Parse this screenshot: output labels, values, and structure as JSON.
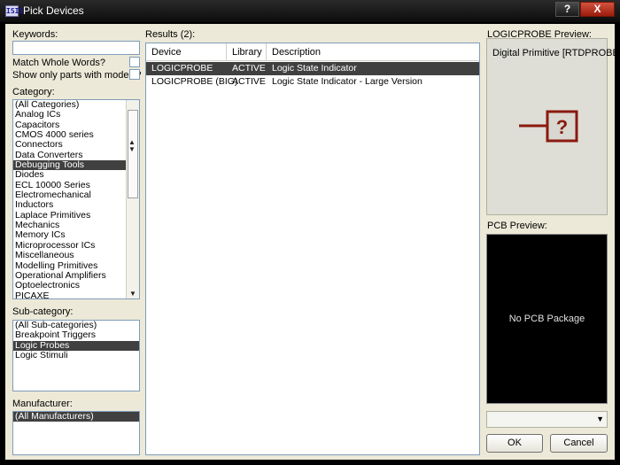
{
  "window": {
    "title": "Pick Devices",
    "app_icon": "ISIS",
    "help_label": "?",
    "close_label": "X"
  },
  "keywords": {
    "label": "Keywords:",
    "value": "",
    "match_whole_words": "Match Whole Words?",
    "show_only_models": "Show only parts with models?"
  },
  "category": {
    "label": "Category:",
    "items": [
      "(All Categories)",
      "Analog ICs",
      "Capacitors",
      "CMOS 4000 series",
      "Connectors",
      "Data Converters",
      "Debugging Tools",
      "Diodes",
      "ECL 10000 Series",
      "Electromechanical",
      "Inductors",
      "Laplace Primitives",
      "Mechanics",
      "Memory ICs",
      "Microprocessor ICs",
      "Miscellaneous",
      "Modelling Primitives",
      "Operational Amplifiers",
      "Optoelectronics",
      "PICAXE"
    ],
    "selected": "Debugging Tools"
  },
  "subcategory": {
    "label": "Sub-category:",
    "items": [
      "(All Sub-categories)",
      "Breakpoint Triggers",
      "Logic Probes",
      "Logic Stimuli"
    ],
    "selected": "Logic Probes"
  },
  "manufacturer": {
    "label": "Manufacturer:",
    "items": [
      "(All Manufacturers)"
    ],
    "selected": "(All Manufacturers)"
  },
  "results": {
    "label": "Results (2):",
    "columns": [
      "Device",
      "Library",
      "Description"
    ],
    "rows": [
      [
        "LOGICPROBE",
        "ACTIVE",
        "Logic State Indicator"
      ],
      [
        "LOGICPROBE (BIG)",
        "ACTIVE",
        "Logic State Indicator - Large Version"
      ]
    ]
  },
  "preview": {
    "label": "LOGICPROBE Preview:",
    "caption": "Digital Primitive [RTDPROBE]",
    "symbol_text": "?"
  },
  "pcb": {
    "label": "PCB Preview:",
    "text": "No PCB Package"
  },
  "buttons": {
    "ok": "OK",
    "cancel": "Cancel"
  },
  "colors": {
    "accent_red": "#8a1a10",
    "selection": "#404040"
  }
}
